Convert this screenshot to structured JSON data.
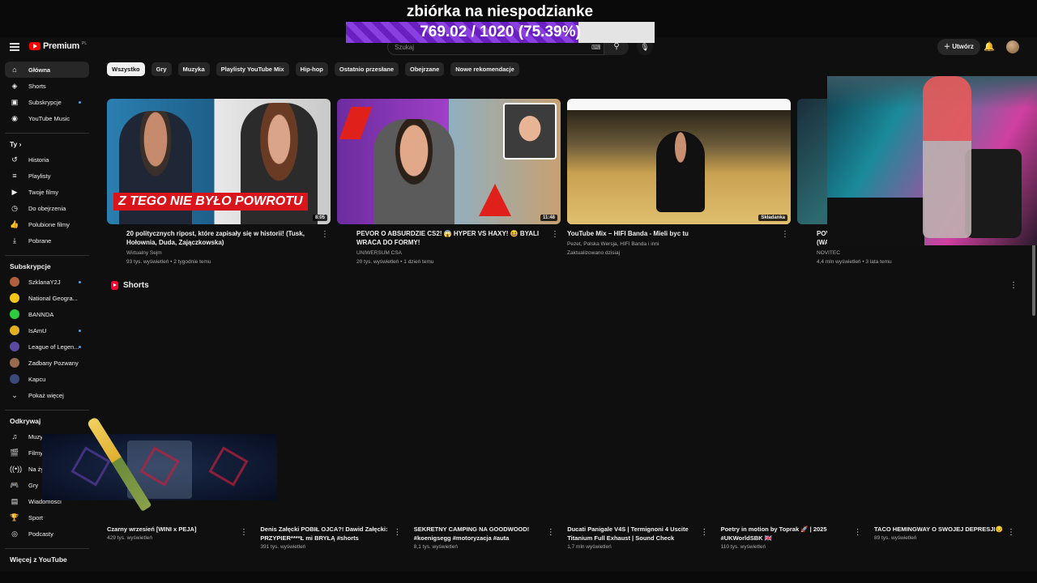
{
  "overlay": {
    "goal_title": "zbiórka na niespodzianke",
    "goal_text": "769.02 / 1020 (75.39%)",
    "goal_progress": 0.7539
  },
  "header": {
    "logo": "Premium",
    "logo_region": "PL",
    "search_placeholder": "Szukaj",
    "create_label": "Utwórz",
    "icons": [
      "menu-icon",
      "keyboard-icon",
      "search-icon",
      "mic-icon",
      "plus-icon",
      "bell-icon"
    ]
  },
  "sidebar": {
    "main": [
      {
        "label": "Główna",
        "icon": "⌂",
        "active": true
      },
      {
        "label": "Shorts",
        "icon": "◈"
      },
      {
        "label": "Subskrypcje",
        "icon": "▣",
        "dot": true
      },
      {
        "label": "YouTube Music",
        "icon": "◉"
      }
    ],
    "you_heading": "Ty",
    "you": [
      {
        "label": "Historia",
        "icon": "↺"
      },
      {
        "label": "Playlisty",
        "icon": "≡"
      },
      {
        "label": "Twoje filmy",
        "icon": "▶"
      },
      {
        "label": "Do obejrzenia",
        "icon": "◷"
      },
      {
        "label": "Polubione filmy",
        "icon": "👍"
      },
      {
        "label": "Pobrane",
        "icon": "⤓"
      }
    ],
    "subs_heading": "Subskrypcje",
    "subs": [
      {
        "label": "SzklanaY2J",
        "color": "#b0603a",
        "dot": true
      },
      {
        "label": "National Geogra...",
        "color": "#f5c518"
      },
      {
        "label": "BANNDA",
        "color": "#2ecc40"
      },
      {
        "label": "IsAmU",
        "color": "#e0b020",
        "dot": true
      },
      {
        "label": "League of Legen...",
        "color": "#5a4aa0",
        "dot": true
      },
      {
        "label": "Zadbany Pozwany",
        "color": "#9a6a50"
      },
      {
        "label": "Kapcu",
        "color": "#3a4a7a"
      }
    ],
    "show_more": "Pokaż więcej",
    "explore_heading": "Odkrywaj",
    "explore": [
      {
        "label": "Muzyka",
        "icon": "♫"
      },
      {
        "label": "Filmy",
        "icon": "🎬"
      },
      {
        "label": "Na żywo",
        "icon": "((•))"
      },
      {
        "label": "Gry",
        "icon": "🎮"
      },
      {
        "label": "Wiadomości",
        "icon": "▤"
      },
      {
        "label": "Sport",
        "icon": "🏆"
      },
      {
        "label": "Podcasty",
        "icon": "◎"
      }
    ],
    "more_heading": "Więcej z YouTube"
  },
  "chips": [
    "Wszystko",
    "Gry",
    "Muzyka",
    "Playlisty YouTube Mix",
    "Hip-hop",
    "Ostatnio przesłane",
    "Obejrzane",
    "Nowe rekomendacje"
  ],
  "videos": [
    {
      "title": "20 politycznych ripost, które zapisały się w historii! (Tusk, Hołownia, Duda, Zajączkowska)",
      "channel": "Wirtualny Sejm",
      "stats": "93 tys. wyświetleń • 2 tygodnie temu",
      "duration": "8:05",
      "banner": "Z TEGO NIE BYŁO POWROTU"
    },
    {
      "title": "PEVOR O ABSURDZIE CS2! 😱 HYPER VS HAXY! 😆 BYALI WRACA DO FORMY!",
      "channel": "UNIWERSUM CSA",
      "stats": "20 tys. wyświetleń • 1 dzień temu",
      "duration": "11:48"
    },
    {
      "title": "YouTube Mix – HIFI Banda - Mieli byc tu",
      "channel": "Pezet, Polska Wersja, HIFI Banda i inni",
      "stats": "Zaktualizowano dzisiaj",
      "duration": "Składanka"
    },
    {
      "title": "POV",
      "title2": "(WA",
      "channel": "NOVITEC",
      "stats": "4,4 mln wyświetleń • 3 lata temu"
    }
  ],
  "shorts_heading": "Shorts",
  "shorts": [
    {
      "title": "Czarny wrzesień [WINI x PEJA]",
      "stats": "429 tys. wyświetleń"
    },
    {
      "title": "Denis Załęcki POBIŁ OJCA?! Dawid Załęcki: PRZYPIER****Ł mi BRYŁĄ #shorts",
      "stats": "391 tys. wyświetleń"
    },
    {
      "title": "SEKRETNY CAMPING NA GOODWOOD! #koenigsegg #motoryzacja #auta",
      "stats": "8,1 tys. wyświetleń"
    },
    {
      "title": "Ducati Panigale V4S | Termignoni 4 Uscite Titanium Full Exhaust | Sound Check",
      "stats": "1,7 mln wyświetleń"
    },
    {
      "title": "Poetry in motion by Toprak 🚀 | 2025 #UKWorldSBK 🇬🇧",
      "stats": "110 tys. wyświetleń"
    },
    {
      "title": "TACO HEMINGWAY O SWOJEJ DEPRESJI😔",
      "stats": "89 tys. wyświetleń"
    }
  ]
}
